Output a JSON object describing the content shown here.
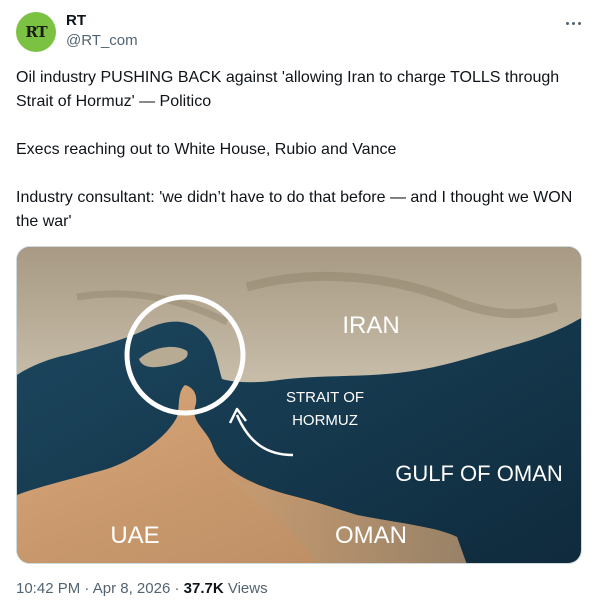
{
  "author": {
    "name": "RT",
    "handle": "@RT_com",
    "avatar_text": "RT",
    "avatar_color": "#7cc242"
  },
  "tweet": {
    "paragraphs": [
      "Oil industry PUSHING BACK against 'allowing Iran to charge TOLLS through Strait of Hormuz' — Politico",
      "Execs reaching out to White House, Rubio and Vance",
      "Industry consultant: 'we didn’t have to do that before — and I thought we WON the war'"
    ]
  },
  "map": {
    "labels": {
      "iran": "IRAN",
      "strait_line1": "STRAIT OF",
      "strait_line2": "HORMUZ",
      "gulf": "GULF OF OMAN",
      "uae": "UAE",
      "oman": "OMAN"
    },
    "colors": {
      "sea": "#14344a",
      "land": "#b8ad96",
      "desert": "#c89768"
    }
  },
  "footer": {
    "time": "10:42 PM",
    "separator": "·",
    "date": "Apr 8, 2026",
    "views_count": "37.7K",
    "views_label": "Views"
  },
  "icons": [
    "more-options-icon"
  ]
}
